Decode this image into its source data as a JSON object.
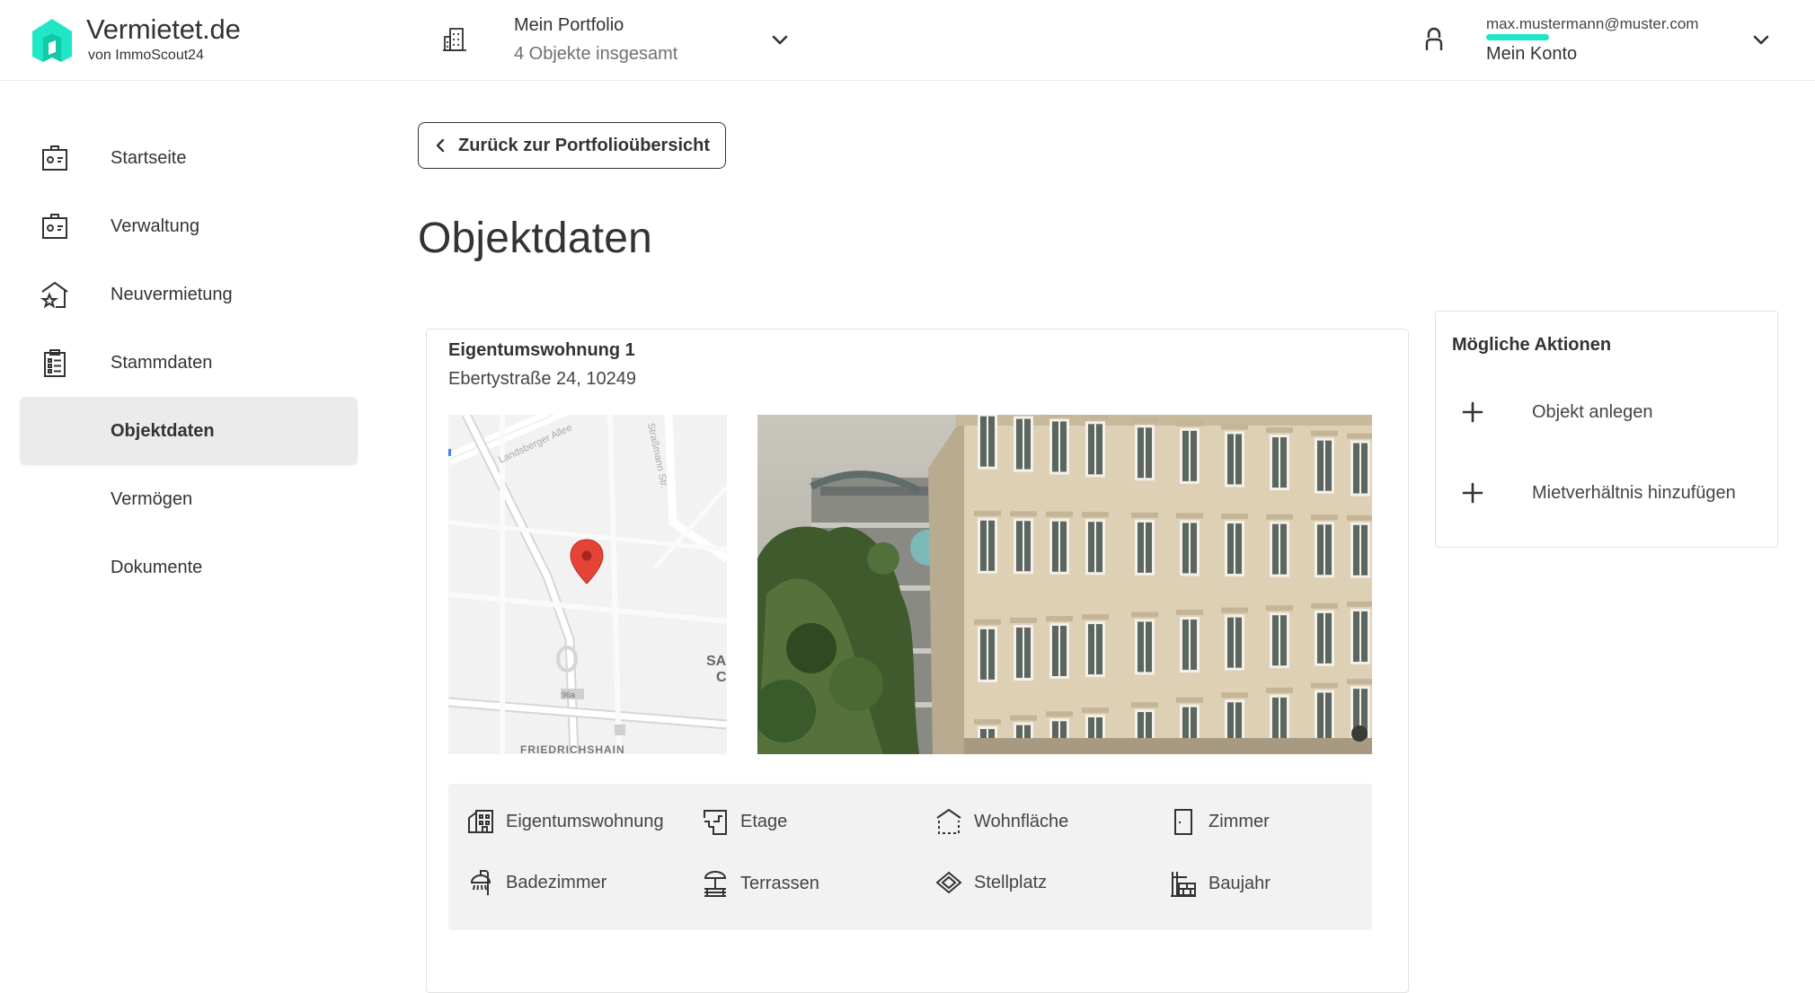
{
  "header": {
    "logo_title": "Vermietet.de",
    "logo_sub": "von ImmoScout24",
    "portfolio_title": "Mein Portfolio",
    "portfolio_sub": "4 Objekte insgesamt",
    "account_email": "max.mustermann@muster.com",
    "account_name": "Mein Konto",
    "accent_color": "#1fe6c4"
  },
  "sidebar": {
    "items": [
      {
        "label": "Startseite",
        "icon": "house-wallet-icon"
      },
      {
        "label": "Verwaltung",
        "icon": "house-wallet-icon"
      },
      {
        "label": "Neuvermietung",
        "icon": "house-star-icon"
      },
      {
        "label": "Stammdaten",
        "icon": "clipboard-icon"
      },
      {
        "label": "Objektdaten",
        "icon": "",
        "active": true
      },
      {
        "label": "Vermögen",
        "icon": ""
      },
      {
        "label": "Dokumente",
        "icon": ""
      }
    ]
  },
  "main": {
    "back_label": "Zurück zur Portfolioübersicht",
    "page_title": "Objektdaten",
    "property": {
      "title": "Eigentumswohnung 1",
      "address": "Ebertystraße 24, 10249"
    },
    "map": {
      "street_1": "Landsberger Allee",
      "street_2": "Straßmann Str.",
      "district": "FRIEDRICHSHAIN",
      "road_label": "96a",
      "partial_label": "SA",
      "partial_label_2": "C"
    },
    "features": [
      {
        "label": "Eigentumswohnung",
        "icon": "building-icon"
      },
      {
        "label": "Etage",
        "icon": "stairs-icon"
      },
      {
        "label": "Wohnfläche",
        "icon": "area-icon"
      },
      {
        "label": "Zimmer",
        "icon": "door-icon"
      },
      {
        "label": "Badezimmer",
        "icon": "shower-icon"
      },
      {
        "label": "Terrassen",
        "icon": "terrace-icon"
      },
      {
        "label": "Stellplatz",
        "icon": "parking-icon"
      },
      {
        "label": "Baujahr",
        "icon": "construction-icon"
      }
    ]
  },
  "actions": {
    "title": "Mögliche Aktionen",
    "items": [
      {
        "label": "Objekt anlegen"
      },
      {
        "label": "Mietverhältnis hinzufügen"
      }
    ]
  }
}
